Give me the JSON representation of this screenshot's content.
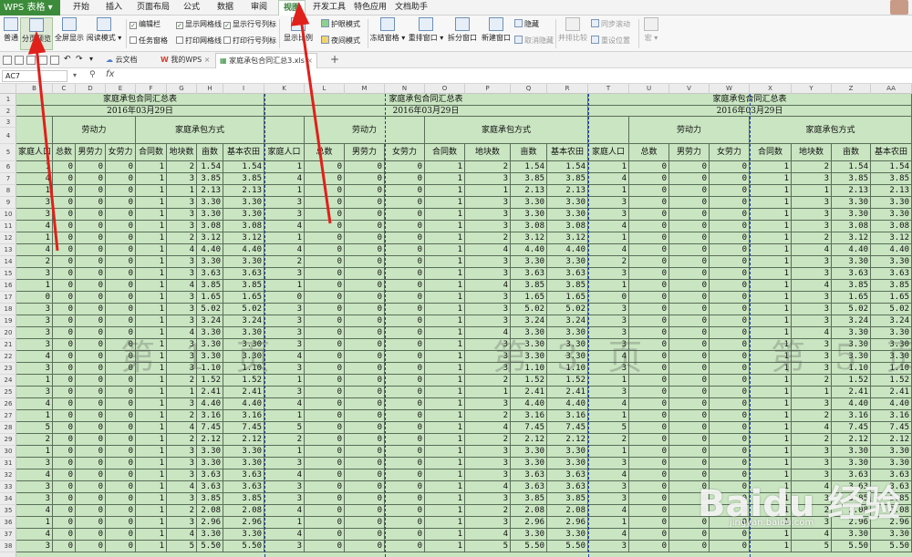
{
  "menubar": {
    "app": "WPS 表格",
    "tabs": [
      "开始",
      "插入",
      "页面布局",
      "公式",
      "数据",
      "审阅",
      "视图",
      "开发工具",
      "特色应用",
      "文档助手"
    ],
    "active_tab": "视图"
  },
  "ribbon": {
    "buttons": [
      "普通",
      "分页预览",
      "全屏显示",
      "阅读模式"
    ],
    "checks": [
      "编辑栏",
      "显示网格线",
      "显示行号列标",
      "任务窗格",
      "打印网格线",
      "打印行号列标"
    ],
    "zoom": "显示比例",
    "eye": "护眼模式",
    "night": "夜间模式",
    "freeze": "冻结窗格",
    "rearrange": "重排窗口",
    "split": "拆分窗口",
    "newwin": "新建窗口",
    "hide": "隐藏",
    "unhide": "取消隐藏",
    "compare": "并排比较",
    "sync": "同步滚动",
    "reset": "重设位置",
    "macro": "宏"
  },
  "docbar": {
    "tabs": [
      "云文档",
      "我的WPS",
      "家庭承包合同汇总3.xls"
    ],
    "plus": "+"
  },
  "formula": {
    "namebox": "AC7",
    "fx": "fx"
  },
  "columns": [
    "A",
    "B",
    "C",
    "D",
    "E",
    "F",
    "G",
    "H",
    "I",
    "K",
    "L",
    "M",
    "N",
    "O",
    "P",
    "Q",
    "R",
    "T",
    "U",
    "V",
    "W",
    "X",
    "Y",
    "Z",
    "AA"
  ],
  "sheet": {
    "title": "家庭承包合同汇总表",
    "date": "2016年03月29日",
    "labor": "劳动力",
    "contract": "家庭承包方式",
    "h_people": "家庭人口",
    "h_total": "总数",
    "h_male": "男劳力",
    "h_female": "女劳力",
    "h_cnum": "合同数",
    "h_plots": "地块数",
    "h_mu": "亩数",
    "h_basic": "基本农田"
  },
  "row_numbers": [
    "1",
    "2",
    "3",
    "4",
    "5",
    "6",
    "7",
    "8",
    "9",
    "10",
    "11",
    "12",
    "13",
    "14",
    "15",
    "16",
    "17",
    "18",
    "19",
    "20",
    "21",
    "22",
    "23",
    "24",
    "25",
    "26",
    "27",
    "28",
    "29",
    "30",
    "31",
    "32",
    "33",
    "34",
    "35",
    "36",
    "37",
    "38"
  ],
  "rows": [
    {
      "p": "1",
      "c": "1",
      "k": "2",
      "m": "1.54"
    },
    {
      "p": "4",
      "c": "1",
      "k": "3",
      "m": "3.85"
    },
    {
      "p": "1",
      "c": "1",
      "k": "1",
      "m": "2.13"
    },
    {
      "p": "3",
      "c": "1",
      "k": "3",
      "m": "3.30"
    },
    {
      "p": "3",
      "c": "1",
      "k": "3",
      "m": "3.30"
    },
    {
      "p": "4",
      "c": "1",
      "k": "3",
      "m": "3.08"
    },
    {
      "p": "1",
      "c": "1",
      "k": "2",
      "m": "3.12"
    },
    {
      "p": "4",
      "c": "1",
      "k": "4",
      "m": "4.40"
    },
    {
      "p": "2",
      "c": "1",
      "k": "3",
      "m": "3.30"
    },
    {
      "p": "3",
      "c": "1",
      "k": "3",
      "m": "3.63"
    },
    {
      "p": "1",
      "c": "1",
      "k": "4",
      "m": "3.85"
    },
    {
      "p": "0",
      "c": "1",
      "k": "3",
      "m": "1.65"
    },
    {
      "p": "3",
      "c": "1",
      "k": "3",
      "m": "5.02"
    },
    {
      "p": "3",
      "c": "1",
      "k": "3",
      "m": "3.24"
    },
    {
      "p": "3",
      "c": "1",
      "k": "4",
      "m": "3.30"
    },
    {
      "p": "3",
      "c": "1",
      "k": "3",
      "m": "3.30"
    },
    {
      "p": "4",
      "c": "1",
      "k": "3",
      "m": "3.30"
    },
    {
      "p": "3",
      "c": "1",
      "k": "3",
      "m": "1.10"
    },
    {
      "p": "1",
      "c": "1",
      "k": "2",
      "m": "1.52"
    },
    {
      "p": "3",
      "c": "1",
      "k": "1",
      "m": "2.41"
    },
    {
      "p": "4",
      "c": "1",
      "k": "3",
      "m": "4.40"
    },
    {
      "p": "1",
      "c": "1",
      "k": "2",
      "m": "3.16"
    },
    {
      "p": "5",
      "c": "1",
      "k": "4",
      "m": "7.45"
    },
    {
      "p": "2",
      "c": "1",
      "k": "2",
      "m": "2.12"
    },
    {
      "p": "1",
      "c": "1",
      "k": "3",
      "m": "3.30"
    },
    {
      "p": "3",
      "c": "1",
      "k": "3",
      "m": "3.30"
    },
    {
      "p": "4",
      "c": "1",
      "k": "3",
      "m": "3.63"
    },
    {
      "p": "3",
      "c": "1",
      "k": "4",
      "m": "3.63"
    },
    {
      "p": "3",
      "c": "1",
      "k": "3",
      "m": "3.85"
    },
    {
      "p": "4",
      "c": "1",
      "k": "2",
      "m": "2.08"
    },
    {
      "p": "1",
      "c": "1",
      "k": "3",
      "m": "2.96"
    },
    {
      "p": "4",
      "c": "1",
      "k": "4",
      "m": "3.30"
    },
    {
      "p": "3",
      "c": "1",
      "k": "5",
      "m": "5.50"
    }
  ],
  "watermarks": [
    "第 1 页",
    "第 3 页",
    "第 5 页"
  ],
  "baidu": {
    "brand": "Baidu 经验",
    "url": "jingyan.baidu.com"
  }
}
